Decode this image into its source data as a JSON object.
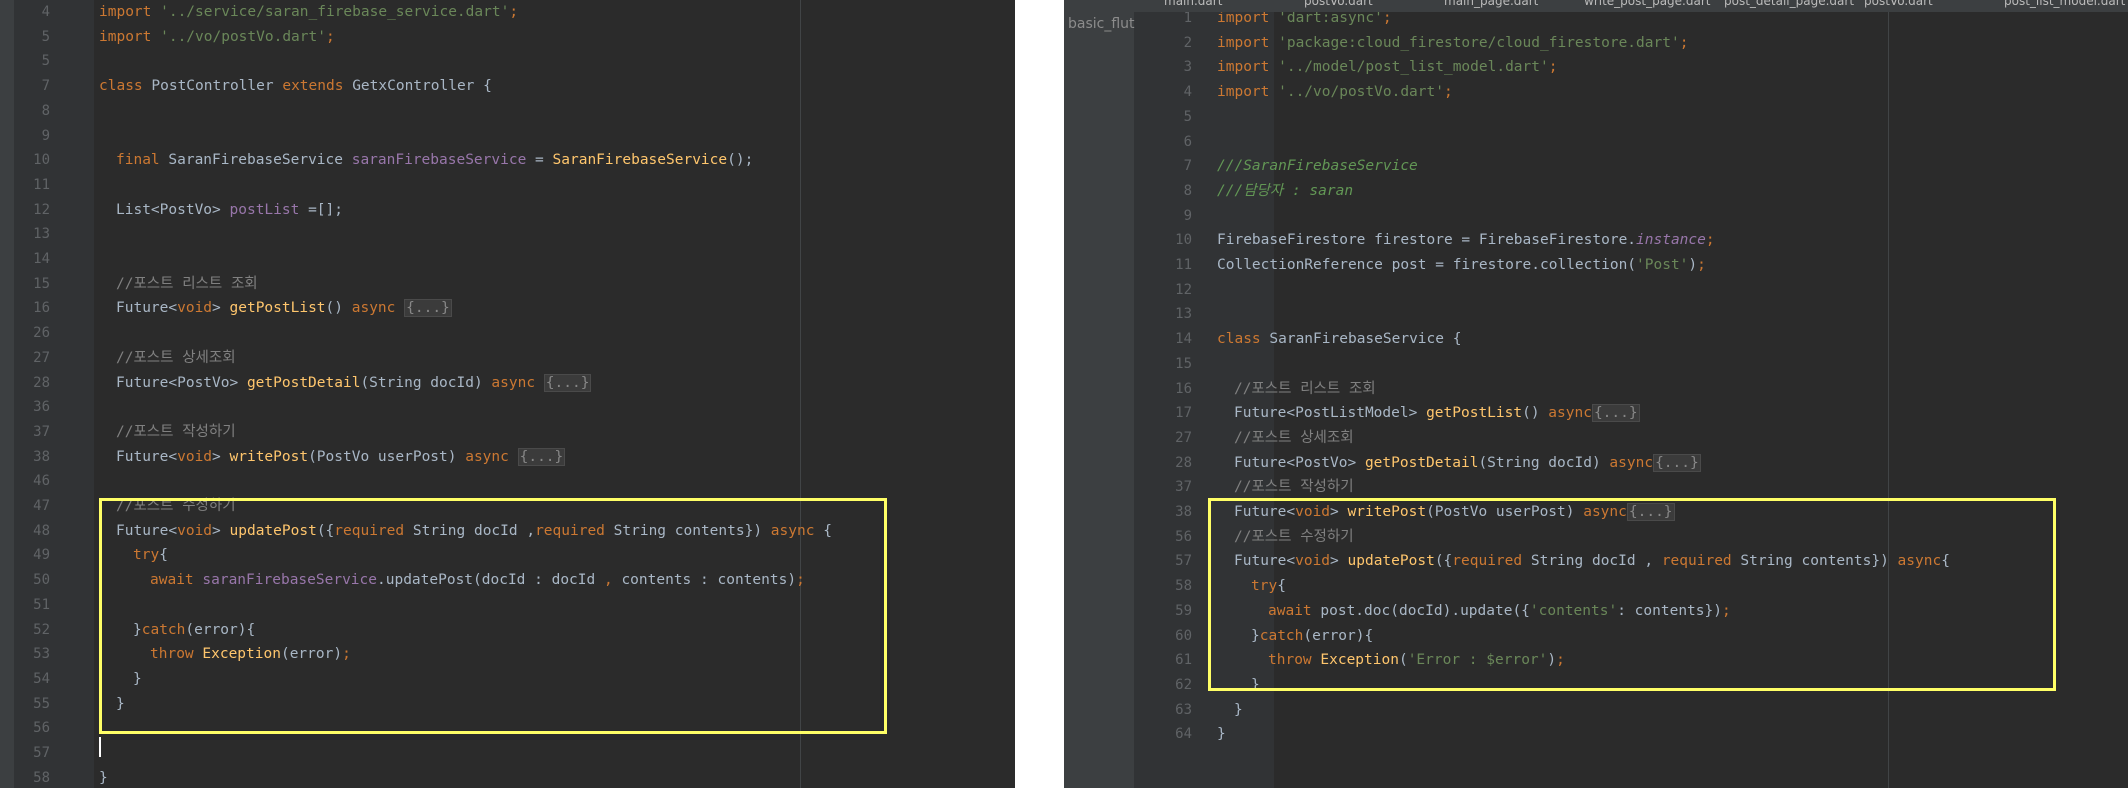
{
  "left": {
    "lines": [
      {
        "n": "4",
        "indent": 0,
        "parts": [
          [
            "kw",
            "import "
          ],
          [
            "str",
            "'../service/saran_firebase_service.dart'"
          ],
          [
            "kw",
            ";"
          ]
        ]
      },
      {
        "n": "5",
        "indent": 0,
        "parts": [
          [
            "kw",
            "import "
          ],
          [
            "str",
            "'../vo/postVo.dart'"
          ],
          [
            "kw",
            ";"
          ]
        ]
      },
      {
        "n": "5",
        "indent": 0,
        "parts": []
      },
      {
        "n": "7",
        "indent": 0,
        "parts": [
          [
            "kw",
            "class "
          ],
          [
            "",
            "PostController "
          ],
          [
            "kw",
            "extends "
          ],
          [
            "",
            "GetxController {"
          ]
        ]
      },
      {
        "n": "8",
        "indent": 0,
        "parts": []
      },
      {
        "n": "9",
        "indent": 0,
        "parts": []
      },
      {
        "n": "10",
        "indent": 1,
        "parts": [
          [
            "kw",
            "final "
          ],
          [
            "",
            "SaranFirebaseService "
          ],
          [
            "fld",
            "saranFirebaseService"
          ],
          [
            "",
            " = "
          ],
          [
            "fn",
            "SaranFirebaseService"
          ],
          [
            "",
            "();"
          ]
        ]
      },
      {
        "n": "11",
        "indent": 0,
        "parts": []
      },
      {
        "n": "12",
        "indent": 1,
        "parts": [
          [
            "",
            "List<PostVo> "
          ],
          [
            "fld",
            "postList"
          ],
          [
            "",
            " =[];"
          ]
        ]
      },
      {
        "n": "13",
        "indent": 0,
        "parts": []
      },
      {
        "n": "14",
        "indent": 0,
        "parts": []
      },
      {
        "n": "15",
        "indent": 1,
        "parts": [
          [
            "cmt",
            "//포스트 리스트 조회"
          ]
        ]
      },
      {
        "n": "16",
        "indent": 1,
        "parts": [
          [
            "",
            "Future<"
          ],
          [
            "kw",
            "void"
          ],
          [
            "",
            "> "
          ],
          [
            "fn",
            "getPostList"
          ],
          [
            "",
            "() "
          ],
          [
            "kw",
            "async "
          ],
          [
            "fold-ph",
            "{...}"
          ]
        ]
      },
      {
        "n": "26",
        "indent": 0,
        "parts": []
      },
      {
        "n": "27",
        "indent": 1,
        "parts": [
          [
            "cmt",
            "//포스트 상세조회"
          ]
        ]
      },
      {
        "n": "28",
        "indent": 1,
        "parts": [
          [
            "",
            "Future<PostVo> "
          ],
          [
            "fn",
            "getPostDetail"
          ],
          [
            "",
            "(String docId) "
          ],
          [
            "kw",
            "async "
          ],
          [
            "fold-ph",
            "{...}"
          ]
        ]
      },
      {
        "n": "36",
        "indent": 0,
        "parts": []
      },
      {
        "n": "37",
        "indent": 1,
        "parts": [
          [
            "cmt",
            "//포스트 작성하기"
          ]
        ]
      },
      {
        "n": "38",
        "indent": 1,
        "parts": [
          [
            "",
            "Future<"
          ],
          [
            "kw",
            "void"
          ],
          [
            "",
            "> "
          ],
          [
            "fn",
            "writePost"
          ],
          [
            "",
            "(PostVo userPost) "
          ],
          [
            "kw",
            "async "
          ],
          [
            "fold-ph",
            "{...}"
          ]
        ]
      },
      {
        "n": "46",
        "indent": 0,
        "parts": []
      },
      {
        "n": "47",
        "indent": 1,
        "parts": [
          [
            "cmt",
            "//포스트 수정하기"
          ]
        ]
      },
      {
        "n": "48",
        "indent": 1,
        "parts": [
          [
            "",
            "Future<"
          ],
          [
            "kw",
            "void"
          ],
          [
            "",
            "> "
          ],
          [
            "fn",
            "updatePost"
          ],
          [
            "",
            "({"
          ],
          [
            "kw",
            "required "
          ],
          [
            "",
            "String docId ,"
          ],
          [
            "kw",
            "required "
          ],
          [
            "",
            "String contents}) "
          ],
          [
            "kw",
            "async "
          ],
          [
            "",
            "{"
          ]
        ]
      },
      {
        "n": "49",
        "indent": 2,
        "parts": [
          [
            "kw",
            "try"
          ],
          [
            "",
            "{"
          ]
        ]
      },
      {
        "n": "50",
        "indent": 3,
        "parts": [
          [
            "kw",
            "await "
          ],
          [
            "fld",
            "saranFirebaseService"
          ],
          [
            "",
            ".updatePost(docId : docId "
          ],
          [
            "kw",
            ", "
          ],
          [
            "",
            "contents : contents)"
          ],
          [
            "kw",
            ";"
          ]
        ]
      },
      {
        "n": "51",
        "indent": 0,
        "parts": []
      },
      {
        "n": "52",
        "indent": 2,
        "parts": [
          [
            "",
            "}"
          ],
          [
            "kw",
            "catch"
          ],
          [
            "",
            "(error){"
          ]
        ]
      },
      {
        "n": "53",
        "indent": 3,
        "parts": [
          [
            "kw",
            "throw "
          ],
          [
            "fn",
            "Exception"
          ],
          [
            "",
            "(error)"
          ],
          [
            "kw",
            ";"
          ]
        ]
      },
      {
        "n": "54",
        "indent": 2,
        "parts": [
          [
            "",
            "}"
          ]
        ]
      },
      {
        "n": "55",
        "indent": 1,
        "parts": [
          [
            "",
            "}"
          ]
        ]
      },
      {
        "n": "56",
        "indent": 0,
        "parts": []
      },
      {
        "n": "57",
        "indent": 0,
        "parts": []
      },
      {
        "n": "58",
        "indent": 0,
        "parts": [
          [
            "",
            "}"
          ]
        ]
      }
    ]
  },
  "right": {
    "tabs": [
      "main.dart",
      "postVo.dart",
      "main_page.dart",
      "write_post_page.dart",
      "post_detail_page.dart",
      "postVo.dart",
      "post_list_model.dart"
    ],
    "project_label": "basic_flut",
    "lines": [
      {
        "n": "1",
        "indent": 0,
        "parts": [
          [
            "kw",
            "import "
          ],
          [
            "str",
            "'dart:async'"
          ],
          [
            "kw",
            ";"
          ]
        ]
      },
      {
        "n": "2",
        "indent": 0,
        "parts": [
          [
            "kw",
            "import "
          ],
          [
            "str",
            "'package:cloud_firestore/cloud_firestore.dart'"
          ],
          [
            "kw",
            ";"
          ]
        ]
      },
      {
        "n": "3",
        "indent": 0,
        "parts": [
          [
            "kw",
            "import "
          ],
          [
            "str",
            "'../model/post_list_model.dart'"
          ],
          [
            "kw",
            ";"
          ]
        ]
      },
      {
        "n": "4",
        "indent": 0,
        "parts": [
          [
            "kw",
            "import "
          ],
          [
            "str",
            "'../vo/postVo.dart'"
          ],
          [
            "kw",
            ";"
          ]
        ]
      },
      {
        "n": "5",
        "indent": 0,
        "parts": []
      },
      {
        "n": "6",
        "indent": 0,
        "parts": []
      },
      {
        "n": "7",
        "indent": 0,
        "parts": [
          [
            "doc",
            "///SaranFirebaseService"
          ]
        ]
      },
      {
        "n": "8",
        "indent": 0,
        "parts": [
          [
            "doc",
            "///담당자 : saran"
          ]
        ]
      },
      {
        "n": "9",
        "indent": 0,
        "parts": []
      },
      {
        "n": "10",
        "indent": 0,
        "parts": [
          [
            "",
            "FirebaseFirestore firestore = FirebaseFirestore."
          ],
          [
            "ital",
            "instance"
          ],
          [
            "kw",
            ";"
          ]
        ]
      },
      {
        "n": "11",
        "indent": 0,
        "parts": [
          [
            "",
            "CollectionReference post = firestore.collection("
          ],
          [
            "str",
            "'Post'"
          ],
          [
            "",
            ")"
          ],
          [
            "kw",
            ";"
          ]
        ]
      },
      {
        "n": "12",
        "indent": 0,
        "parts": []
      },
      {
        "n": "13",
        "indent": 0,
        "parts": []
      },
      {
        "n": "14",
        "indent": 0,
        "parts": [
          [
            "kw",
            "class "
          ],
          [
            "",
            "SaranFirebaseService {"
          ]
        ]
      },
      {
        "n": "15",
        "indent": 0,
        "parts": []
      },
      {
        "n": "16",
        "indent": 1,
        "parts": [
          [
            "cmt",
            "//포스트 리스트 조회"
          ]
        ]
      },
      {
        "n": "17",
        "indent": 1,
        "parts": [
          [
            "",
            "Future<PostListModel> "
          ],
          [
            "fn",
            "getPostList"
          ],
          [
            "",
            "() "
          ],
          [
            "kw",
            "async"
          ],
          [
            "fold-ph",
            "{...}"
          ]
        ]
      },
      {
        "n": "27",
        "indent": 1,
        "parts": [
          [
            "cmt",
            "//포스트 상세조회"
          ]
        ]
      },
      {
        "n": "28",
        "indent": 1,
        "parts": [
          [
            "",
            "Future<PostVo> "
          ],
          [
            "fn",
            "getPostDetail"
          ],
          [
            "",
            "(String docId) "
          ],
          [
            "kw",
            "async"
          ],
          [
            "fold-ph",
            "{...}"
          ]
        ]
      },
      {
        "n": "37",
        "indent": 1,
        "parts": [
          [
            "cmt",
            "//포스트 작성하기"
          ]
        ]
      },
      {
        "n": "38",
        "indent": 1,
        "parts": [
          [
            "",
            "Future<"
          ],
          [
            "kw",
            "void"
          ],
          [
            "",
            "> "
          ],
          [
            "fn",
            "writePost"
          ],
          [
            "",
            "(PostVo userPost) "
          ],
          [
            "kw",
            "async"
          ],
          [
            "fold-ph",
            "{...}"
          ]
        ]
      },
      {
        "n": "56",
        "indent": 1,
        "parts": [
          [
            "cmt",
            "//포스트 수정하기"
          ]
        ]
      },
      {
        "n": "57",
        "indent": 1,
        "parts": [
          [
            "",
            "Future<"
          ],
          [
            "kw",
            "void"
          ],
          [
            "",
            "> "
          ],
          [
            "fn",
            "updatePost"
          ],
          [
            "",
            "({"
          ],
          [
            "kw",
            "required "
          ],
          [
            "",
            "String docId , "
          ],
          [
            "kw",
            "required "
          ],
          [
            "",
            "String contents}) "
          ],
          [
            "kw",
            "async"
          ],
          [
            "",
            "{"
          ]
        ]
      },
      {
        "n": "58",
        "indent": 2,
        "parts": [
          [
            "kw",
            "try"
          ],
          [
            "",
            "{"
          ]
        ]
      },
      {
        "n": "59",
        "indent": 3,
        "parts": [
          [
            "kw",
            "await "
          ],
          [
            "",
            "post.doc(docId).update({"
          ],
          [
            "str",
            "'contents'"
          ],
          [
            "",
            ": contents})"
          ],
          [
            "kw",
            ";"
          ]
        ]
      },
      {
        "n": "60",
        "indent": 2,
        "parts": [
          [
            "",
            "}"
          ],
          [
            "kw",
            "catch"
          ],
          [
            "",
            "(error){"
          ]
        ]
      },
      {
        "n": "61",
        "indent": 3,
        "parts": [
          [
            "kw",
            "throw "
          ],
          [
            "fn",
            "Exception"
          ],
          [
            "",
            "("
          ],
          [
            "str",
            "'Error : $error'"
          ],
          [
            "",
            ")"
          ],
          [
            "kw",
            ";"
          ]
        ]
      },
      {
        "n": "62",
        "indent": 2,
        "parts": [
          [
            "",
            "}"
          ]
        ]
      },
      {
        "n": "63",
        "indent": 1,
        "parts": [
          [
            "",
            "}"
          ]
        ]
      },
      {
        "n": "64",
        "indent": 0,
        "parts": [
          [
            "",
            "}"
          ]
        ]
      }
    ]
  },
  "colors": {
    "keyword": "#cc7832",
    "function": "#ffc66d",
    "field": "#9876aa",
    "string": "#6a8759",
    "comment": "#808080",
    "highlight": "#ffff66"
  }
}
